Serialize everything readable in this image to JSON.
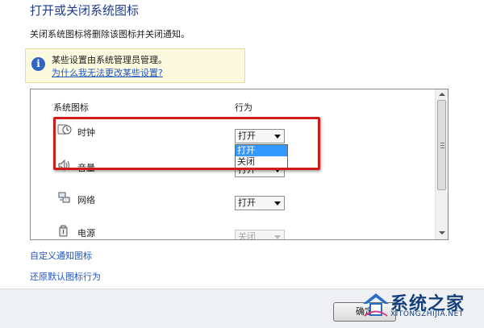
{
  "page": {
    "title": "打开或关闭系统图标",
    "description": "关闭系统图标将删除该图标并关闭通知。"
  },
  "info_bar": {
    "icon": "info-icon",
    "text": "某些设置由系统管理员管理。",
    "link": "为什么我无法更改某些设置?"
  },
  "table": {
    "col_icon": "系统图标",
    "col_behavior": "行为",
    "rows": [
      {
        "label": "时钟",
        "value": "打开",
        "icon": "clock-icon",
        "enabled": true
      },
      {
        "label": "音量",
        "value": "打开",
        "icon": "volume-icon",
        "enabled": true
      },
      {
        "label": "网络",
        "value": "打开",
        "icon": "network-icon",
        "enabled": true
      },
      {
        "label": "电源",
        "value": "关闭",
        "icon": "power-icon",
        "enabled": false
      }
    ]
  },
  "dropdown_open": {
    "options": [
      "打开",
      "关闭"
    ],
    "selected": "打开"
  },
  "links": {
    "customize": "自定义通知图标",
    "restore": "还原默认图标行为"
  },
  "footer": {
    "ok_partial": "确定"
  },
  "watermark": {
    "text": "系统之家",
    "url": "XITONGZHIJIA.NET"
  },
  "colors": {
    "title": "#1e3c8c",
    "link": "#1f55c9",
    "highlight": "#d01b1b",
    "selected": "#3399ff"
  }
}
